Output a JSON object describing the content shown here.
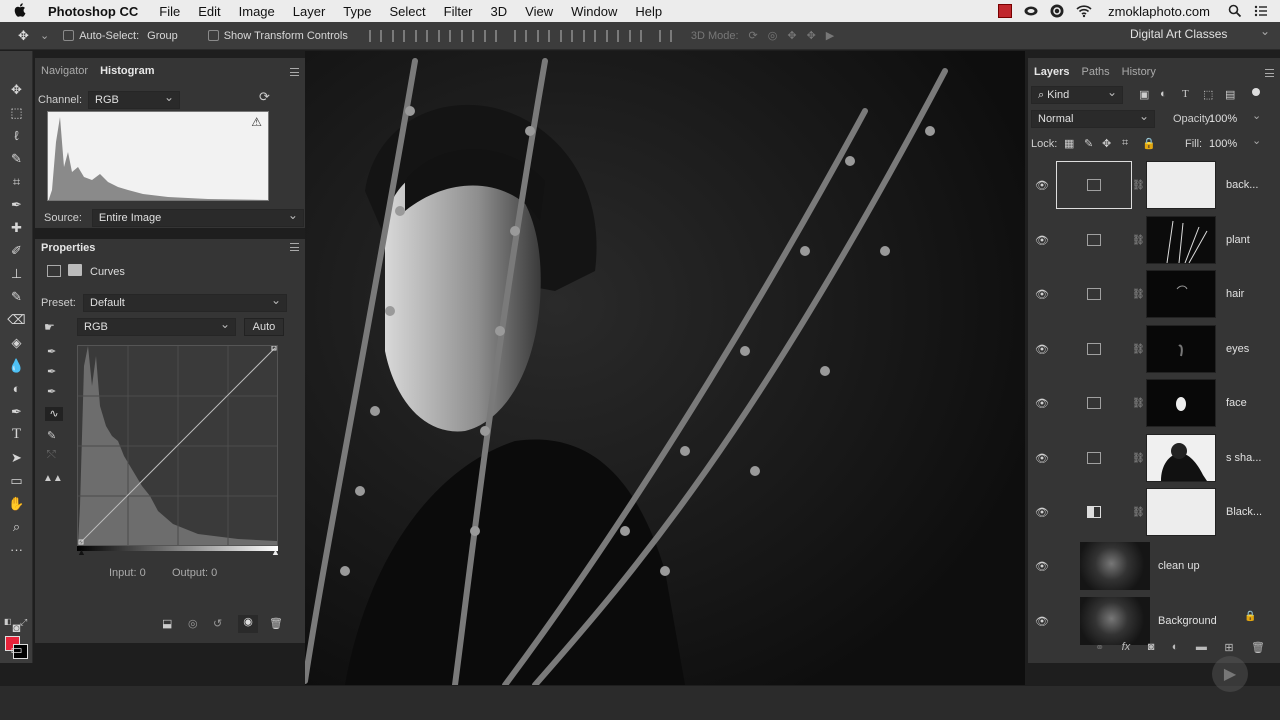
{
  "menubar": {
    "app_name": "Photoshop CC",
    "items": [
      "File",
      "Edit",
      "Image",
      "Layer",
      "Type",
      "Select",
      "Filter",
      "3D",
      "View",
      "Window",
      "Help"
    ],
    "site": "zmoklaphoto.com"
  },
  "options": {
    "auto_select_label": "Auto-Select:",
    "auto_select_value": "Group",
    "show_transform_label": "Show Transform Controls",
    "mode_3d_label": "3D Mode:",
    "workspace": "Digital Art Classes"
  },
  "histogram_panel": {
    "tabs": [
      "Navigator",
      "Histogram"
    ],
    "channel_label": "Channel:",
    "channel_value": "RGB",
    "source_label": "Source:",
    "source_value": "Entire Image"
  },
  "properties_panel": {
    "title": "Properties",
    "adjustment_name": "Curves",
    "preset_label": "Preset:",
    "preset_value": "Default",
    "channel_value": "RGB",
    "auto_button": "Auto",
    "input_label": "Input: 0",
    "output_label": "Output: 0"
  },
  "layers_panel": {
    "tabs": [
      "Layers",
      "Paths",
      "History"
    ],
    "filter_kind": "Kind",
    "blend_mode": "Normal",
    "opacity_label": "Opacity:",
    "opacity_value": "100%",
    "lock_label": "Lock:",
    "fill_label": "Fill:",
    "fill_value": "100%",
    "layers": [
      {
        "name": "back...",
        "kind": "curves",
        "mask": "white"
      },
      {
        "name": "plant",
        "kind": "curves",
        "mask": "plant"
      },
      {
        "name": "hair",
        "kind": "curves",
        "mask": "dark"
      },
      {
        "name": "eyes",
        "kind": "curves",
        "mask": "dark"
      },
      {
        "name": "face",
        "kind": "curves",
        "mask": "dark"
      },
      {
        "name": "s sha...",
        "kind": "curves",
        "mask": "shadow"
      },
      {
        "name": "Black...",
        "kind": "black-white",
        "mask": "white"
      },
      {
        "name": "clean up",
        "kind": "pixel"
      },
      {
        "name": "Background",
        "kind": "pixel"
      }
    ]
  },
  "colors": {
    "foreground": "#e8233a",
    "background": "#000000"
  }
}
